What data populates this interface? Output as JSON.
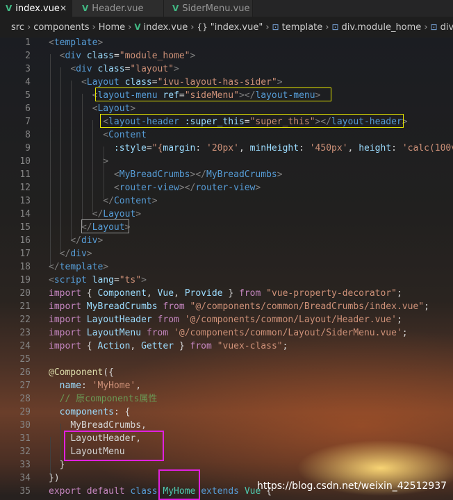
{
  "tabs": [
    {
      "label": "index.vue",
      "active": true
    },
    {
      "label": "Header.vue",
      "active": false
    },
    {
      "label": "SiderMenu.vue",
      "active": false
    }
  ],
  "close_glyph": "✕",
  "vue_icon": "V",
  "breadcrumb": [
    "src",
    "components",
    "Home",
    "index.vue",
    "\"index.vue\"",
    "template",
    "div.module_home",
    "div"
  ],
  "breadcrumb_icons": {
    "vue": "vue-file-icon",
    "braces": "braces-icon",
    "tag": "element-icon"
  },
  "braces_glyph": "{}",
  "tag_glyph": "⊡",
  "separator": "›",
  "lines": [
    "1",
    "2",
    "3",
    "4",
    "5",
    "6",
    "7",
    "8",
    "9",
    "10",
    "11",
    "12",
    "13",
    "14",
    "15",
    "16",
    "17",
    "18",
    "19",
    "20",
    "21",
    "22",
    "23",
    "24",
    "25",
    "26",
    "27",
    "28",
    "29",
    "30",
    "31",
    "32",
    "33",
    "34",
    "35"
  ],
  "watermark": "https://blog.csdn.net/weixin_42512937",
  "colors": {
    "highlight_yellow": "#e6e600",
    "highlight_magenta": "#e020e0",
    "vue_green": "#41b883"
  }
}
